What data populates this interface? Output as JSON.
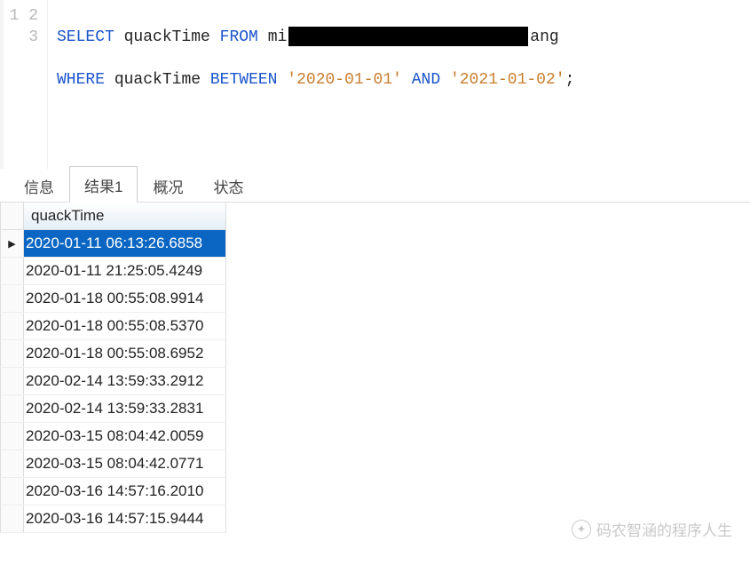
{
  "editor": {
    "lines": [
      "1",
      "2",
      "3"
    ],
    "tokens": {
      "select": "SELECT",
      "col": "quackTime",
      "from": "FROM",
      "table_prefix": "mi",
      "table_suffix": "ang",
      "where": "WHERE",
      "col2": "quackTime",
      "between": "BETWEEN",
      "date1": "'2020-01-01'",
      "and": "AND",
      "date2": "'2021-01-02'",
      "semi": ";"
    }
  },
  "tabs": {
    "items": [
      {
        "label": "信息",
        "active": false
      },
      {
        "label": "结果1",
        "active": true
      },
      {
        "label": "概况",
        "active": false
      },
      {
        "label": "状态",
        "active": false
      }
    ]
  },
  "grid": {
    "column": "quackTime",
    "rows": [
      {
        "value": "2020-01-11 06:13:26.6858",
        "selected": true
      },
      {
        "value": "2020-01-11 21:25:05.4249",
        "selected": false
      },
      {
        "value": "2020-01-18 00:55:08.9914",
        "selected": false
      },
      {
        "value": "2020-01-18 00:55:08.5370",
        "selected": false
      },
      {
        "value": "2020-01-18 00:55:08.6952",
        "selected": false
      },
      {
        "value": "2020-02-14 13:59:33.2912",
        "selected": false
      },
      {
        "value": "2020-02-14 13:59:33.2831",
        "selected": false
      },
      {
        "value": "2020-03-15 08:04:42.0059",
        "selected": false
      },
      {
        "value": "2020-03-15 08:04:42.0771",
        "selected": false
      },
      {
        "value": "2020-03-16 14:57:16.2010",
        "selected": false
      },
      {
        "value": "2020-03-16 14:57:15.9444",
        "selected": false
      }
    ]
  },
  "watermark": {
    "text": "码农智涵的程序人生"
  }
}
